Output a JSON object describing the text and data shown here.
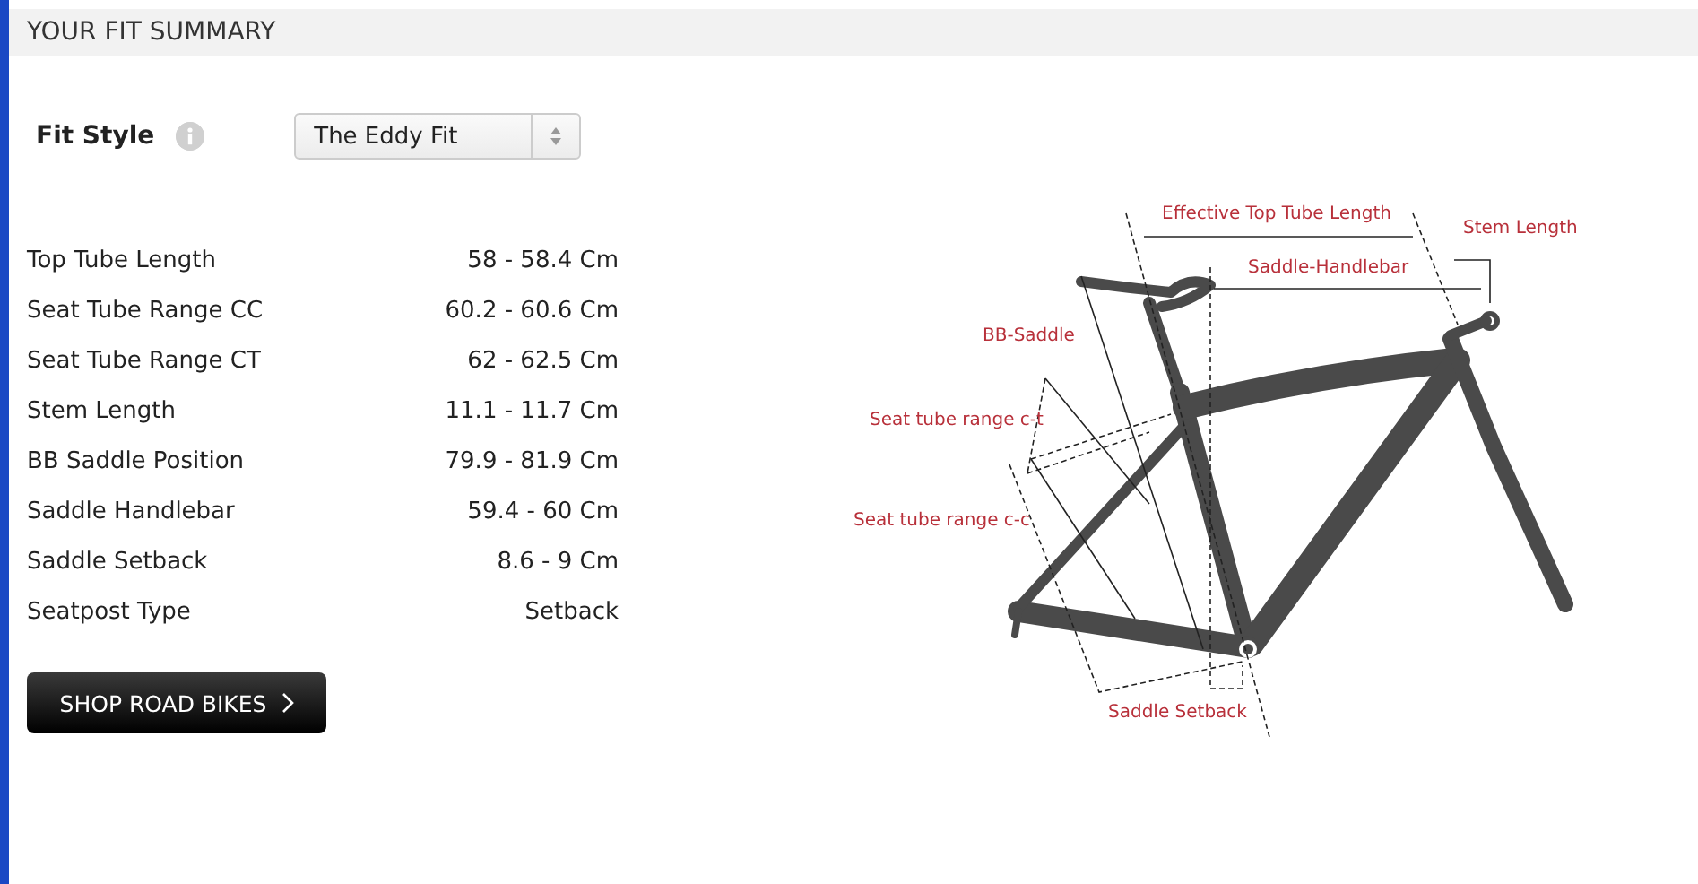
{
  "header": {
    "title": "YOUR FIT SUMMARY"
  },
  "fit_style": {
    "label": "Fit Style",
    "select": {
      "value": "The Eddy Fit"
    }
  },
  "measurements": [
    {
      "name": "Top Tube Length",
      "value": "58 - 58.4 Cm"
    },
    {
      "name": "Seat Tube Range CC",
      "value": "60.2 - 60.6 Cm"
    },
    {
      "name": "Seat Tube Range CT",
      "value": "62 - 62.5 Cm"
    },
    {
      "name": "Stem Length",
      "value": "11.1 - 11.7 Cm"
    },
    {
      "name": "BB Saddle Position",
      "value": "79.9 - 81.9 Cm"
    },
    {
      "name": "Saddle Handlebar",
      "value": "59.4 - 60 Cm"
    },
    {
      "name": "Saddle Setback",
      "value": "8.6 - 9 Cm"
    },
    {
      "name": "Seatpost Type",
      "value": "Setback"
    }
  ],
  "shop_button": {
    "label": "SHOP ROAD BIKES"
  },
  "diagram": {
    "labels": [
      "Effective Top Tube Length",
      "Stem Length",
      "Saddle-Handlebar",
      "BB-Saddle",
      "Seat tube range c-t",
      "Seat tube range c-c",
      "Saddle Setback"
    ]
  }
}
